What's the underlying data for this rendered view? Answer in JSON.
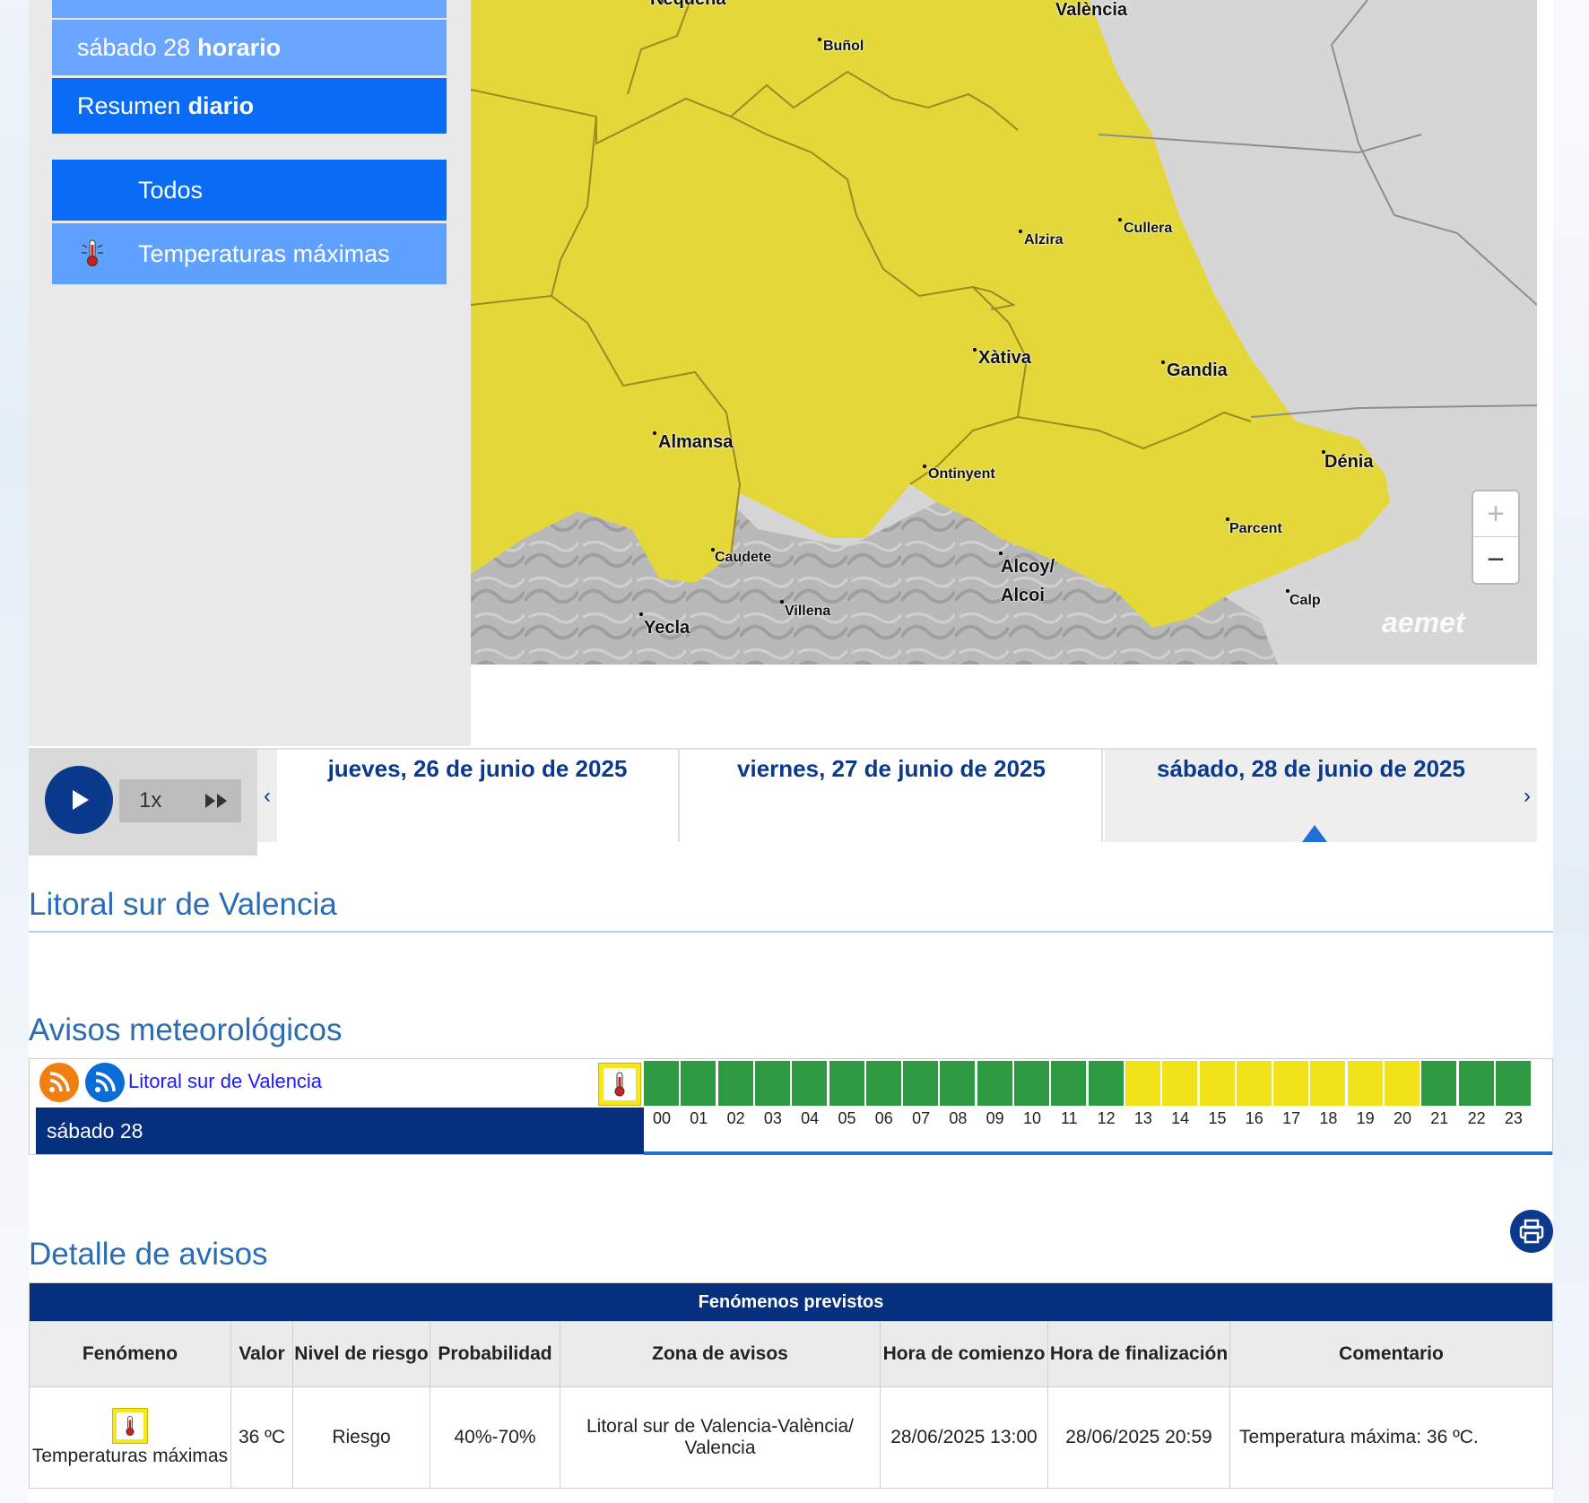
{
  "sidebar": {
    "items": [
      {
        "label": "sábado 28",
        "bold": "horario"
      },
      {
        "label": "Resumen",
        "bold": "diario"
      }
    ],
    "filters": [
      "Todos",
      "Temperaturas máximas"
    ]
  },
  "map": {
    "towns": [
      "Requena",
      "València",
      "Buñol",
      "Cullera",
      "Alzira",
      "Gandia",
      "Xàtiva",
      "Almansa",
      "Ontinyent",
      "Dénia",
      "Parcent",
      "Caudete",
      "Alcoy/",
      "Alcoi",
      "Calp",
      "Villena",
      "Yecla"
    ],
    "zoom_in": "+",
    "zoom_out": "−",
    "logo": "aemet",
    "colors": {
      "warning_yellow": "#e3d73a",
      "sea": "#d6d6d6",
      "terrain": "#b8b8b8"
    }
  },
  "player": {
    "speed": "1x"
  },
  "days": [
    "jueves, 26 de junio de 2025",
    "viernes, 27 de junio de 2025",
    "sábado, 28 de junio de 2025"
  ],
  "zone_title": "Litoral sur de Valencia",
  "avisos": {
    "title": "Avisos meteorológicos",
    "zone_link": "Litoral sur de Valencia",
    "day_label": "sábado 28",
    "hours": [
      "00",
      "01",
      "02",
      "03",
      "04",
      "05",
      "06",
      "07",
      "08",
      "09",
      "10",
      "11",
      "12",
      "13",
      "14",
      "15",
      "16",
      "17",
      "18",
      "19",
      "20",
      "21",
      "22",
      "23"
    ],
    "levels": [
      "green",
      "green",
      "green",
      "green",
      "green",
      "green",
      "green",
      "green",
      "green",
      "green",
      "green",
      "green",
      "green",
      "yellow",
      "yellow",
      "yellow",
      "yellow",
      "yellow",
      "yellow",
      "yellow",
      "yellow",
      "green",
      "green",
      "green"
    ],
    "colors": {
      "green": "#2e9a42",
      "yellow": "#f1e21a"
    }
  },
  "detalle": {
    "title": "Detalle de avisos",
    "caption": "Fenómenos previstos",
    "headers": [
      "Fenómeno",
      "Valor",
      "Nivel de riesgo",
      "Probabilidad",
      "Zona de avisos",
      "Hora de comienzo",
      "Hora de finalización",
      "Comentario"
    ],
    "row": {
      "fenomeno": "Temperaturas máximas",
      "valor": "36 ºC",
      "nivel": "Riesgo",
      "probabilidad": "40%-70%",
      "zona": "Litoral sur de Valencia-València/ Valencia",
      "comienzo": "28/06/2025 13:00",
      "fin": "28/06/2025 20:59",
      "comentario": "Temperatura máxima: 36 ºC."
    }
  }
}
